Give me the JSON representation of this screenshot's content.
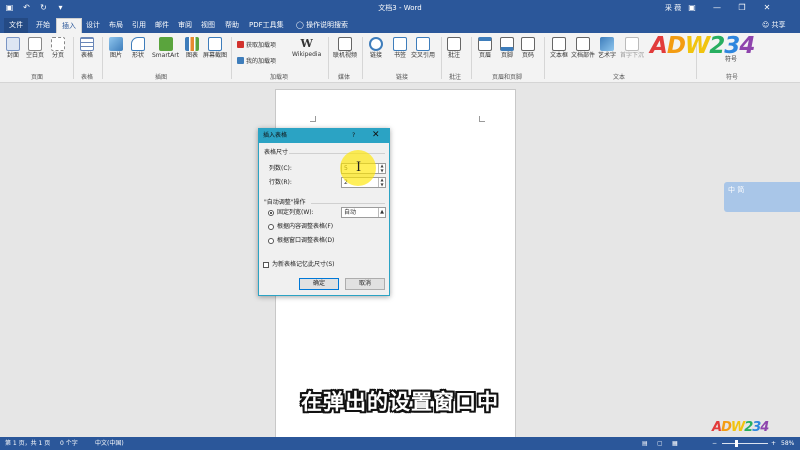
{
  "titlebar": {
    "doc_title": "文档3 - Word",
    "user": "采 薇",
    "qat_icons": [
      "save-icon",
      "undo-icon",
      "redo-icon",
      "customize-icon"
    ]
  },
  "tabs": {
    "file": "文件",
    "items": [
      "开始",
      "插入",
      "设计",
      "布局",
      "引用",
      "邮件",
      "审阅",
      "视图",
      "帮助",
      "PDF工具集"
    ],
    "active": "插入",
    "help_search": "操作说明搜索",
    "share": "共享"
  },
  "ribbon": {
    "pages": {
      "cover": "封面",
      "blank": "空白页",
      "break": "分页",
      "label": "页面"
    },
    "tables": {
      "table": "表格",
      "label": "表格"
    },
    "illustrations": {
      "pictures": "图片",
      "shapes": "形状",
      "smartart": "SmartArt",
      "chart": "图表",
      "screenshot": "屏幕截图",
      "label": "插图"
    },
    "addins": {
      "get": "获取加载项",
      "my": "我的加载项",
      "wikipedia": "Wikipedia",
      "label": "加载项"
    },
    "media": {
      "video": "联机视频",
      "label": "媒体"
    },
    "links": {
      "link": "链接",
      "bookmark": "书签",
      "crossref": "交叉引用",
      "label": "链接"
    },
    "comments": {
      "comment": "批注",
      "label": "批注"
    },
    "header_footer": {
      "header": "页眉",
      "footer": "页脚",
      "pagenum": "页码",
      "label": "页眉和页脚"
    },
    "text": {
      "textbox": "文本框",
      "quickparts": "文档部件",
      "wordart": "艺术字",
      "dropcap": "首字下沉",
      "label": "文本"
    },
    "symbols": {
      "symbol": "符号",
      "label": "符号"
    }
  },
  "dialog": {
    "title": "插入表格",
    "help": "?",
    "close": "✕",
    "table_size_label": "表格尺寸",
    "columns_label": "列数(C):",
    "columns_value": "5",
    "rows_label": "行数(R):",
    "rows_value": "2",
    "autofit_label": "\"自动调整\"操作",
    "fixed_width_label": "固定列宽(W):",
    "fixed_width_value": "自动",
    "autofit_contents_label": "根据内容调整表格(F)",
    "autofit_window_label": "根据窗口调整表格(D)",
    "remember_label": "为新表格记忆此尺寸(S)",
    "ok": "确定",
    "cancel": "取消"
  },
  "subtitle": "在弹出的设置窗口中",
  "watermark": {
    "text": "ADW234",
    "float_text": "中 简",
    "colors": [
      "#e23b3b",
      "#f39c12",
      "#f1c40f",
      "#27ae60",
      "#2e86de",
      "#8e44ad"
    ]
  },
  "status": {
    "page": "第 1 页，共 1 页",
    "words": "0 个字",
    "lang": "中文(中国)",
    "zoom": "58%",
    "zoom_fraction": 0.58
  }
}
